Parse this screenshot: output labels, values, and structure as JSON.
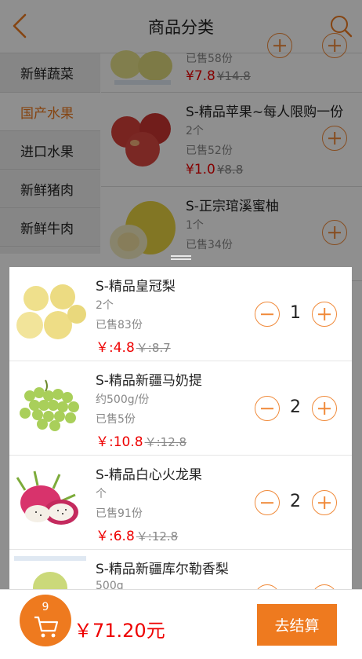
{
  "header": {
    "title": "商品分类"
  },
  "sidebar": {
    "categories": [
      {
        "label": "新鲜蔬菜",
        "active": false
      },
      {
        "label": "国产水果",
        "active": true
      },
      {
        "label": "进口水果",
        "active": false
      },
      {
        "label": "新鲜猪肉",
        "active": false
      },
      {
        "label": "新鲜牛肉",
        "active": false
      }
    ]
  },
  "list": {
    "items": [
      {
        "title": "",
        "sold": "已售58份",
        "price": "¥7.8",
        "original_price": "¥14.8"
      },
      {
        "title": "S-精品苹果~每人限购一份",
        "unit": "2个",
        "sold": "已售52份",
        "price": "¥1.0",
        "original_price": "¥8.8"
      },
      {
        "title": "S-正宗琯溪蜜柚",
        "unit": "1个",
        "sold": "已售34份"
      }
    ]
  },
  "cart": {
    "items": [
      {
        "name": "S-精品皇冠梨",
        "unit": "2个",
        "sold": "已售83份",
        "price": "￥:4.8",
        "original_price": "￥:8.7",
        "qty": "1"
      },
      {
        "name": "S-精品新疆马奶提",
        "unit": "约500g/份",
        "sold": "已售5份",
        "price": "￥:10.8",
        "original_price": "￥:12.8",
        "qty": "2"
      },
      {
        "name": "S-精品白心火龙果",
        "unit": "个",
        "sold": "已售91份",
        "price": "￥:6.8",
        "original_price": "￥:12.8",
        "qty": "2"
      },
      {
        "name": "S-精品新疆库尔勒香梨",
        "unit": "500g"
      }
    ],
    "count_badge": "9",
    "total": "￥71.20元",
    "checkout_label": "去结算"
  },
  "colors": {
    "accent": "#ee7a1f",
    "price_red": "#e00000"
  },
  "icons": [
    "back-arrow-icon",
    "search-icon",
    "shopping-cart-icon",
    "plus-icon",
    "minus-icon"
  ]
}
